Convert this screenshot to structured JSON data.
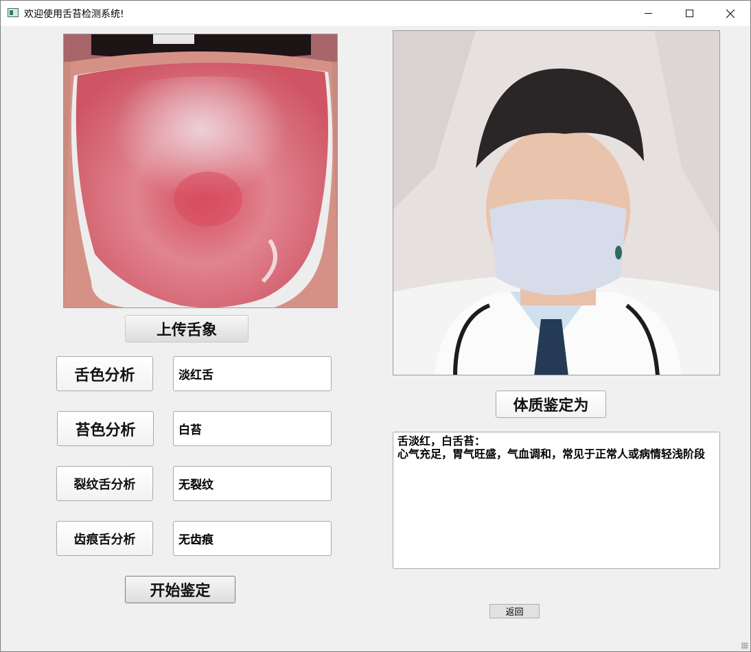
{
  "window": {
    "title": "欢迎使用舌苔检测系统!",
    "icons": {
      "app": "app-window-icon",
      "minimize": "minimize-icon",
      "maximize": "maximize-icon",
      "close": "close-icon"
    }
  },
  "left_panel": {
    "upload_button": "上传舌象",
    "analysis": [
      {
        "button": "舌色分析",
        "result": "淡红舌"
      },
      {
        "button": "苔色分析",
        "result": "白苔"
      },
      {
        "button": "裂纹舌分析",
        "result": "无裂纹"
      },
      {
        "button": "齿痕舌分析",
        "result": "无齿痕"
      }
    ],
    "start_button": "开始鉴定"
  },
  "right_panel": {
    "constitution_label": "体质鉴定为",
    "result_text": "舌淡红，白舌苔：\n心气充足，胃气旺盛，气血调和，常见于正常人或病情轻浅阶段",
    "back_button": "返回"
  }
}
